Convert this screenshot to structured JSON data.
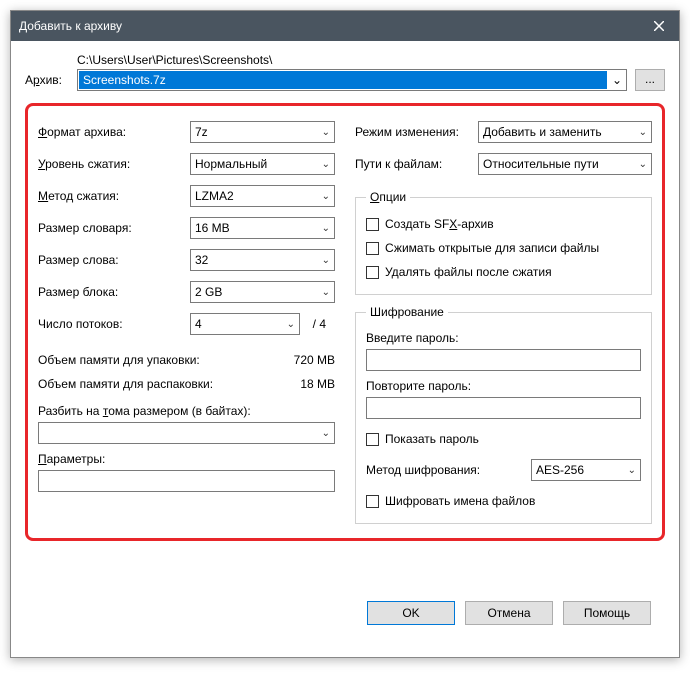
{
  "title": "Добавить к архиву",
  "archive": {
    "label_pre": "А",
    "label_u": "р",
    "label_post": "хив:",
    "path": "C:\\Users\\User\\Pictures\\Screenshots\\",
    "filename": "Screenshots.7z",
    "browse": "..."
  },
  "left": {
    "format": {
      "label_u": "Ф",
      "label_post": "ормат архива:",
      "value": "7z"
    },
    "level": {
      "label_u": "У",
      "label_post": "ровень сжатия:",
      "value": "Нормальный"
    },
    "method": {
      "label_u": "М",
      "label_post": "етод сжатия:",
      "value": "LZMA2"
    },
    "dict": {
      "label": "Размер словаря:",
      "value": "16 MB"
    },
    "word": {
      "label": "Размер слова:",
      "value": "32"
    },
    "block": {
      "label": "Размер блока:",
      "value": "2 GB"
    },
    "threads": {
      "label": "Число потоков:",
      "value": "4",
      "max": "/ 4"
    },
    "mem_pack": {
      "label": "Объем памяти для упаковки:",
      "value": "720 MB"
    },
    "mem_unpack": {
      "label": "Объем памяти для распаковки:",
      "value": "18 MB"
    },
    "split": {
      "label_pre": "Разбить на ",
      "label_u": "т",
      "label_post": "ома размером (в байтах):"
    },
    "params": {
      "label_u": "П",
      "label_post": "араметры:"
    }
  },
  "right": {
    "update": {
      "label": "Режим изменения:",
      "value": "Добавить и заменить"
    },
    "paths": {
      "label": "Пути к файлам:",
      "value": "Относительные пути"
    },
    "options": {
      "legend_u": "О",
      "legend_post": "пции",
      "sfx": {
        "pre": "Создать SF",
        "u": "X",
        "post": "-архив"
      },
      "shared": "Сжимать открытые для записи файлы",
      "delete": "Удалять файлы после сжатия"
    },
    "encryption": {
      "legend": "Шифрование",
      "pw1": "Введите пароль:",
      "pw2": "Повторите пароль:",
      "show": "Показать пароль",
      "method_label": "Метод шифрования:",
      "method_value": "AES-256",
      "encnames": "Шифровать имена файлов"
    }
  },
  "buttons": {
    "ok": "OK",
    "cancel": "Отмена",
    "help": "Помощь"
  }
}
